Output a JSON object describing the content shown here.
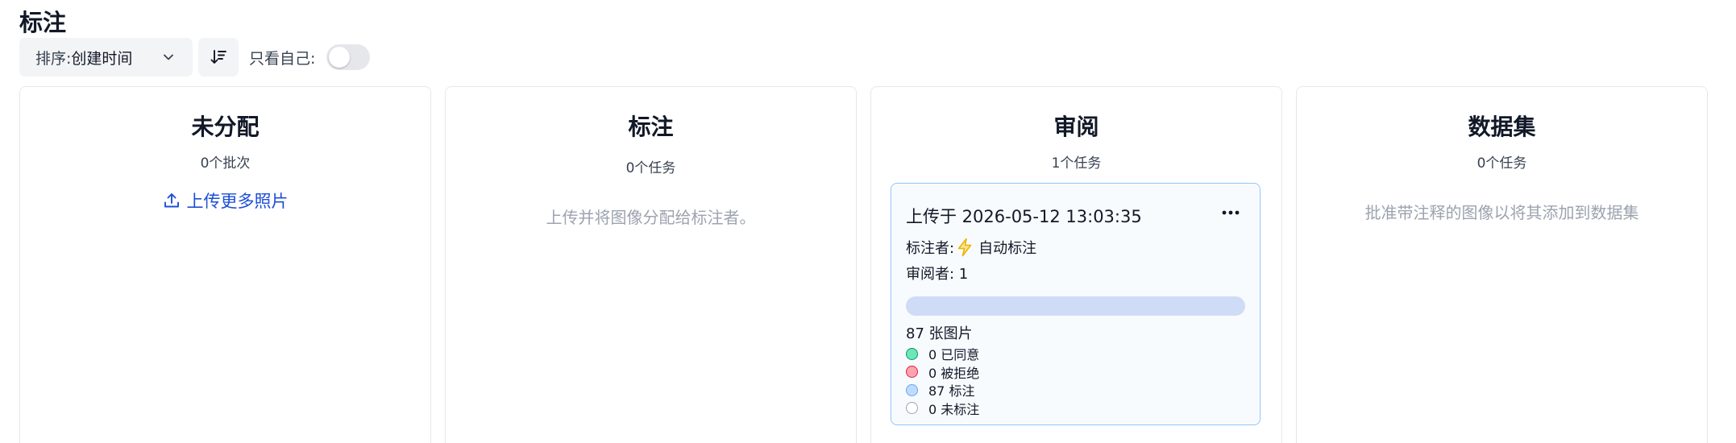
{
  "page": {
    "title": "标注"
  },
  "toolbar": {
    "sort_prefix": "排序:",
    "sort_value": "创建时间",
    "only_mine_label": "只看自己:",
    "only_mine_on": false
  },
  "columns": {
    "unassigned": {
      "title": "未分配",
      "count": "0个批次",
      "upload_label": "上传更多照片"
    },
    "annotate": {
      "title": "标注",
      "count": "0个任务",
      "empty_hint": "上传并将图像分配给标注者。"
    },
    "review": {
      "title": "审阅",
      "count": "1个任务",
      "card": {
        "uploaded": "上传于 2026-05-12 13:03:35",
        "annotator_label": "标注者:",
        "annotator_value": "自动标注",
        "reviewer": "审阅者: 1",
        "images": "87 张图片",
        "progress_fraction": 1.0,
        "legend": [
          {
            "label": "0 已同意",
            "fill": "#6ee7b7",
            "stroke": "#059669"
          },
          {
            "label": "0 被拒绝",
            "fill": "#fda4af",
            "stroke": "#e11d48"
          },
          {
            "label": "87 标注",
            "fill": "#bfdbfe",
            "stroke": "#60a5fa"
          },
          {
            "label": "0 未标注",
            "fill": "#ffffff",
            "stroke": "#9ca3af"
          }
        ]
      }
    },
    "dataset": {
      "title": "数据集",
      "count": "0个任务",
      "empty_hint": "批准带注释的图像以将其添加到数据集"
    }
  },
  "colors": {
    "accent_link": "#1d4ed8",
    "card_border": "#93c5fd",
    "bolt": "#f5c518"
  },
  "icons": [
    "chevron-down-icon",
    "sort-descending-icon",
    "upload-icon",
    "more-horizontal-icon",
    "lightning-icon"
  ]
}
